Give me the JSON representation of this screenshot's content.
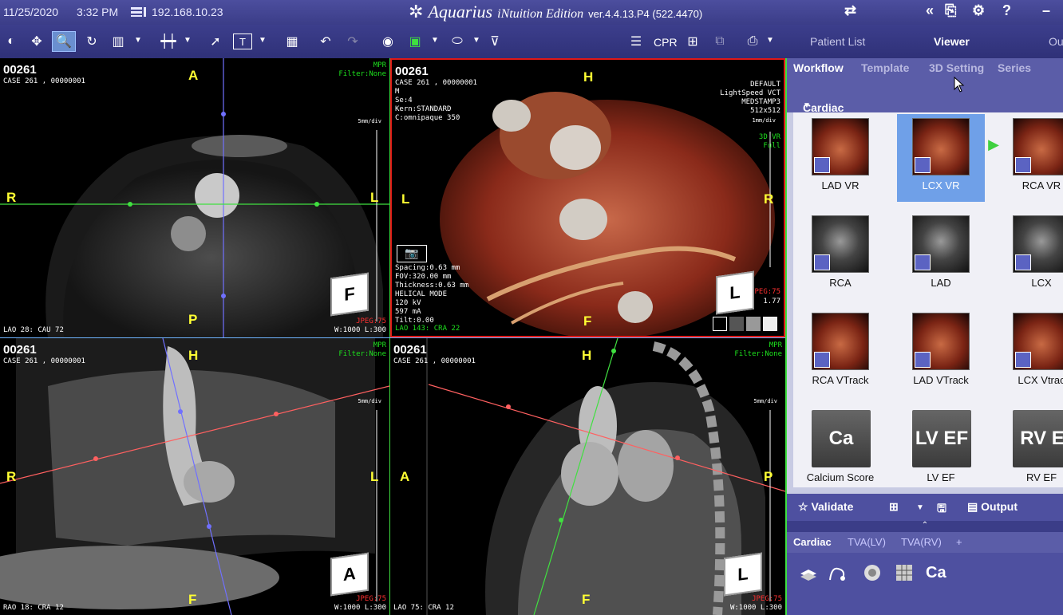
{
  "titlebar": {
    "date": "11/25/2020",
    "time": "3:32 PM",
    "ip": "192.168.10.23",
    "app_name": "Aquarius",
    "edition": "iNtuition Edition",
    "version": "ver.4.4.13.P4 (522.4470)"
  },
  "toolbar": {
    "cpr_label": "CPR",
    "nav_tabs": [
      "Patient List",
      "Viewer",
      "Ou"
    ]
  },
  "viewports": [
    {
      "patient_id": "00261",
      "case_line": "CASE 261 , 00000001",
      "mpr_line1": "MPR",
      "mpr_line2": "Filter:None",
      "orient_top": "A",
      "orient_bottom": "P",
      "orient_left": "R",
      "orient_right": "L",
      "bottom_left": "LAO 28: CAU 72",
      "bottom_right": "W:1000 L:300",
      "jpeg": "JPEG:75",
      "scale": "5mm/div",
      "cube": "F"
    },
    {
      "patient_id": "00261",
      "case_lines": "CASE 261 , 00000001\nM\nSe:4\nKern:STANDARD\nC:omnipaque 350",
      "right_info": "DEFAULT\nLightSpeed VCT\nMEDSTAMP3\n512x512",
      "right_mode": "3D VR\nFull",
      "scale": "1mm/div",
      "orient_top": "H",
      "orient_bottom": "F",
      "orient_left": "L",
      "orient_right": "R",
      "params": "Spacing:0.63 mm\nFOV:320.00 mm\nThickness:0.63 mm\nHELICAL MODE\n120 kV\n597 mA\nTilt:0.00",
      "bottom_left": "LAO 143: CRA 22",
      "zoom": "1.77",
      "jpeg": "JPEG:75",
      "cube": "L"
    },
    {
      "patient_id": "00261",
      "case_line": "CASE 261 , 00000001",
      "mpr_line1": "MPR",
      "mpr_line2": "Filter:None",
      "orient_top": "H",
      "orient_bottom": "F",
      "orient_left": "R",
      "orient_right": "L",
      "bottom_left": "RAO 18: CRA 12",
      "bottom_right": "W:1000 L:300",
      "jpeg": "JPEG:75",
      "scale": "5mm/div",
      "cube": "A"
    },
    {
      "patient_id": "00261",
      "case_line": "CASE 261 , 00000001",
      "mpr_line1": "MPR",
      "mpr_line2": "Filter:None",
      "orient_top": "H",
      "orient_bottom": "F",
      "orient_left": "A",
      "orient_right": "P",
      "bottom_left": "LAO 75: CRA 12",
      "bottom_right": "W:1000 L:300",
      "jpeg": "JPEG:75",
      "scale": "5mm/div",
      "cube": "L"
    }
  ],
  "panel": {
    "tabs": [
      "Workflow",
      "Template",
      "3D Setting",
      "Series"
    ],
    "protocol": "Cardiac",
    "items": [
      {
        "label": "LAD VR",
        "kind": "vr"
      },
      {
        "label": "LCX VR",
        "kind": "vr",
        "selected": true
      },
      {
        "label": "RCA VR",
        "kind": "vr"
      },
      {
        "label": "RCA",
        "kind": "cpr"
      },
      {
        "label": "LAD",
        "kind": "cpr"
      },
      {
        "label": "LCX",
        "kind": "cpr"
      },
      {
        "label": "RCA VTrack",
        "kind": "vr"
      },
      {
        "label": "LAD VTrack",
        "kind": "vr"
      },
      {
        "label": "LCX Vtrac",
        "kind": "vr"
      },
      {
        "label": "Calcium Score",
        "kind": "tile",
        "tile": "Ca"
      },
      {
        "label": "LV EF",
        "kind": "tile",
        "tile": "LV EF"
      },
      {
        "label": "RV EF",
        "kind": "tile",
        "tile": "RV E"
      }
    ],
    "validate_label": "Validate",
    "output_label": "Output",
    "subtabs": [
      "Cardiac",
      "TVA(LV)",
      "TVA(RV)",
      "+"
    ],
    "ca_label": "Ca"
  },
  "colors": {
    "titlebar": "#3b3d88",
    "panel_header": "#5b5da8",
    "selected_item": "#6fa0e8",
    "orientation_text": "#ffff33",
    "mpr_text": "#1de01d",
    "active_viewport_border": "#e01818"
  }
}
